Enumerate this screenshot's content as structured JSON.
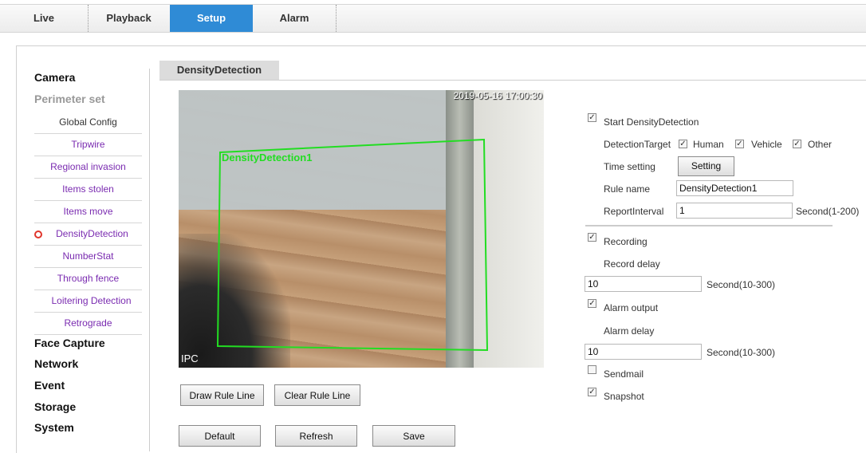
{
  "nav": {
    "tabs": [
      {
        "label": "Live"
      },
      {
        "label": "Playback"
      },
      {
        "label": "Setup"
      },
      {
        "label": "Alarm"
      }
    ],
    "active": "Setup"
  },
  "sidebar": {
    "camera": "Camera",
    "perimeter": "Perimeter set",
    "items": [
      {
        "label": "Global Config"
      },
      {
        "label": "Tripwire"
      },
      {
        "label": "Regional invasion"
      },
      {
        "label": "Items stolen"
      },
      {
        "label": "Items move"
      },
      {
        "label": "DensityDetection"
      },
      {
        "label": "NumberStat"
      },
      {
        "label": "Through fence"
      },
      {
        "label": "Loitering Detection"
      },
      {
        "label": "Retrograde"
      }
    ],
    "sections": [
      "Face Capture",
      "Network",
      "Event",
      "Storage",
      "System"
    ]
  },
  "main": {
    "tab_title": "DensityDetection",
    "video": {
      "timestamp": "2019-05-16 17:00:30",
      "channel": "IPC",
      "rule_label": "DensityDetection1"
    },
    "buttons": {
      "draw": "Draw Rule Line",
      "clear": "Clear Rule Line",
      "default": "Default",
      "refresh": "Refresh",
      "save": "Save"
    }
  },
  "settings": {
    "start_label": "Start DensityDetection",
    "start_checked": true,
    "target_label": "DetectionTarget",
    "targets": [
      {
        "label": "Human",
        "checked": true
      },
      {
        "label": "Vehicle",
        "checked": true
      },
      {
        "label": "Other",
        "checked": true
      }
    ],
    "time_label": "Time setting",
    "time_button": "Setting",
    "rule_label": "Rule name",
    "rule_value": "DensityDetection1",
    "report_label": "ReportInterval",
    "report_value": "1",
    "report_unit": "Second(1-200)",
    "recording_label": "Recording",
    "recording_checked": true,
    "record_delay_label": "Record delay",
    "record_delay_value": "10",
    "record_delay_unit": "Second(10-300)",
    "alarm_output_label": "Alarm output",
    "alarm_output_checked": true,
    "alarm_delay_label": "Alarm delay",
    "alarm_delay_value": "10",
    "alarm_delay_unit": "Second(10-300)",
    "sendmail_label": "Sendmail",
    "sendmail_checked": false,
    "snapshot_label": "Snapshot",
    "snapshot_checked": true
  },
  "colors": {
    "accent": "#2f8bd6",
    "rule_box": "#22dd22",
    "active_dot": "#e0352b",
    "sub_link": "#7a2bb0"
  },
  "icons": [
    "check-icon",
    "active-item-dot-icon"
  ]
}
